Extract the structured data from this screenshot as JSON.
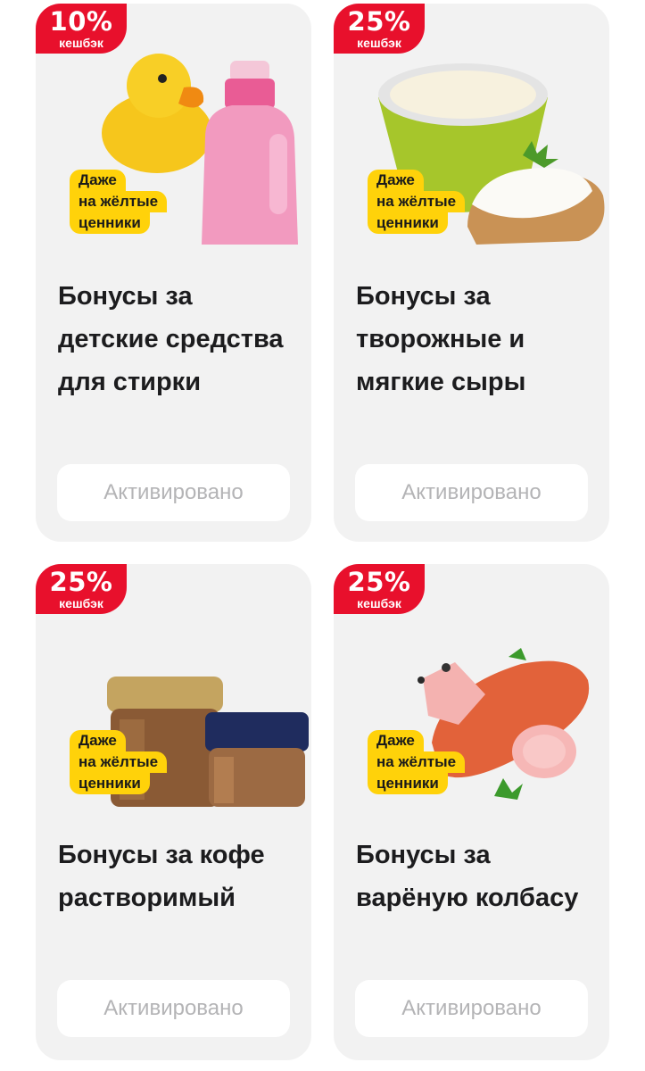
{
  "offers": [
    {
      "percent": "10%",
      "cashback": "кешбэк",
      "tag": [
        "Даже",
        "на жёлтые",
        "ценники"
      ],
      "title": "Бонусы за детские средства для стирки",
      "button": "Активировано",
      "image": "duck-and-detergent-bottle"
    },
    {
      "percent": "25%",
      "cashback": "кешбэк",
      "tag": [
        "Даже",
        "на жёлтые",
        "ценники"
      ],
      "title": "Бонусы за творожные и мягкие сыры",
      "button": "Активировано",
      "image": "cream-cheese-tub-and-toast"
    },
    {
      "percent": "25%",
      "cashback": "кешбэк",
      "tag": [
        "Даже",
        "на жёлтые",
        "ценники"
      ],
      "title": "Бонусы за кофе растворимый",
      "button": "Активировано",
      "image": "instant-coffee-jars"
    },
    {
      "percent": "25%",
      "cashback": "кешбэк",
      "tag": [
        "Даже",
        "на жёлтые",
        "ценники"
      ],
      "title": "Бонусы за варёную колбасу",
      "button": "Активировано",
      "image": "boiled-sausage"
    }
  ],
  "colors": {
    "badge": "#e8102c",
    "tag": "#ffd20a",
    "card": "#f2f2f2",
    "button_text": "#b4b4b6"
  }
}
